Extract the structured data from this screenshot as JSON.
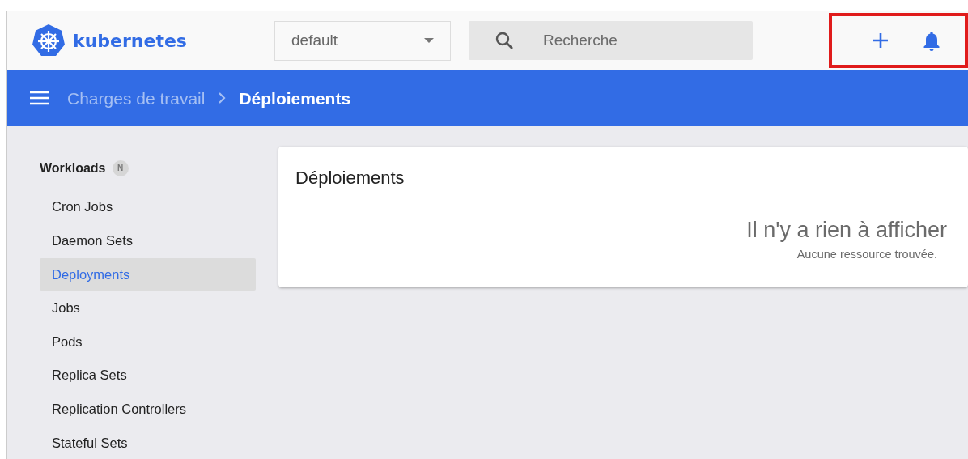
{
  "header": {
    "logo_text": "kubernetes",
    "namespace": "default",
    "search_placeholder": "Recherche",
    "actions_highlighted": true
  },
  "breadcrumb": [
    {
      "label": "Charges de travail",
      "current": false
    },
    {
      "label": "Déploiements",
      "current": true
    }
  ],
  "sidebar": {
    "section": "Workloads",
    "badge": "N",
    "items": [
      {
        "label": "Cron Jobs",
        "selected": false
      },
      {
        "label": "Daemon Sets",
        "selected": false
      },
      {
        "label": "Deployments",
        "selected": true
      },
      {
        "label": "Jobs",
        "selected": false
      },
      {
        "label": "Pods",
        "selected": false
      },
      {
        "label": "Replica Sets",
        "selected": false
      },
      {
        "label": "Replication Controllers",
        "selected": false
      },
      {
        "label": "Stateful Sets",
        "selected": false
      }
    ]
  },
  "card": {
    "title": "Déploiements",
    "empty_title": "Il n'y a rien à afficher",
    "empty_subtitle": "Aucune ressource trouvée."
  }
}
